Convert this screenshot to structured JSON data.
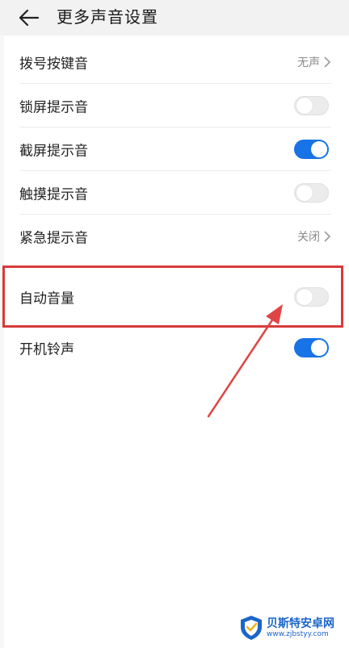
{
  "header": {
    "title": "更多声音设置",
    "back_icon": "arrow-left-icon"
  },
  "settings": [
    {
      "label": "拨号按键音",
      "control": "value",
      "value": "无声"
    },
    {
      "label": "锁屏提示音",
      "control": "toggle",
      "state": "off"
    },
    {
      "label": "截屏提示音",
      "control": "toggle",
      "state": "on"
    },
    {
      "label": "触摸提示音",
      "control": "toggle",
      "state": "off"
    },
    {
      "label": "紧急提示音",
      "control": "value",
      "value": "关闭"
    },
    {
      "label": "自动音量",
      "control": "toggle",
      "state": "off"
    },
    {
      "label": "开机铃声",
      "control": "toggle",
      "state": "on"
    }
  ],
  "annotation": {
    "highlight_color": "#d83a3a",
    "target": "自动音量"
  },
  "watermark": {
    "title": "贝斯特安卓网",
    "url": "www.zjbstyy.com",
    "icon": "shield-logo-icon"
  },
  "colors": {
    "toggle_on": "#1773e6",
    "toggle_off": "#ececec",
    "value_text": "#8a8a8a"
  }
}
